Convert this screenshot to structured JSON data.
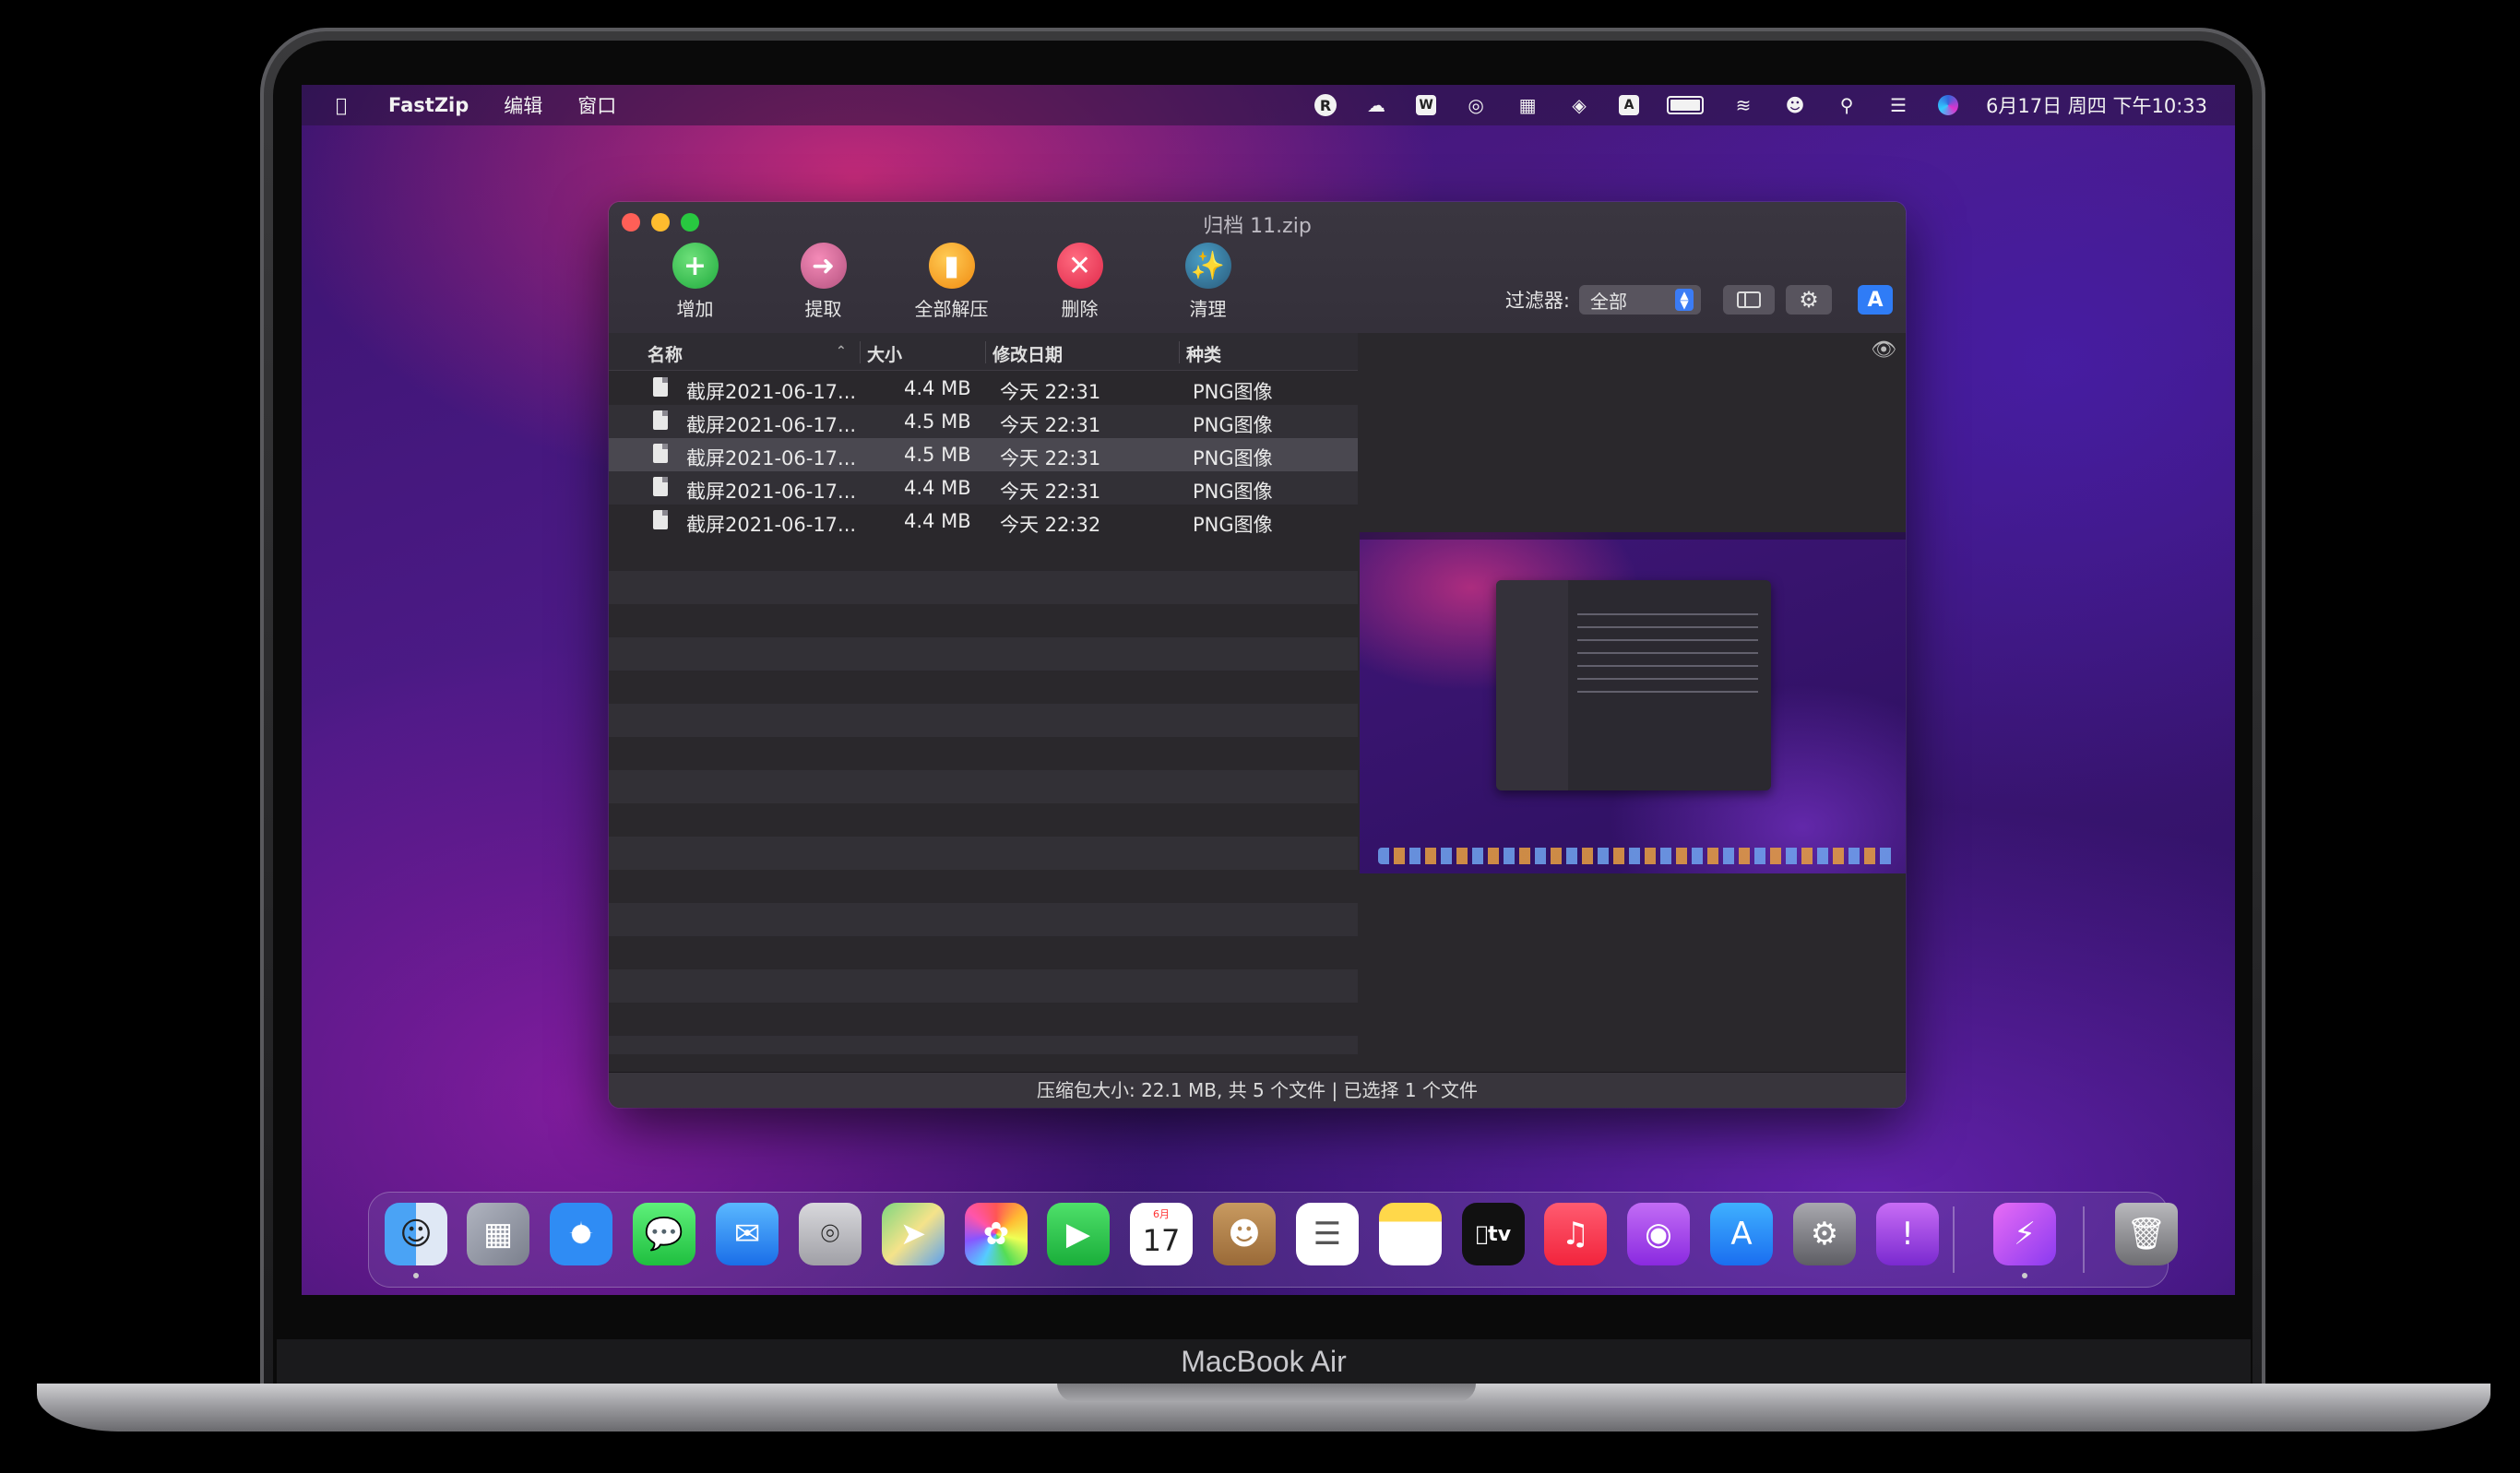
{
  "menubar": {
    "apple_icon": "apple-icon",
    "app_name": "FastZip",
    "menus": [
      "编辑",
      "窗口"
    ],
    "status_icons": [
      "r-badge-icon",
      "creative-cloud-icon",
      "w-badge-icon",
      "fingerprint-icon",
      "grid-icon",
      "layers-icon",
      "input-a-icon",
      "battery-icon",
      "wifi-icon",
      "user-icon",
      "search-icon",
      "control-center-icon",
      "siri-icon"
    ],
    "r_badge": "R",
    "w_badge": "W",
    "a_badge": "A",
    "clock": "6月17日 周四 下午10:33"
  },
  "window": {
    "title": "归档 11.zip",
    "toolbar": {
      "add": "增加",
      "extract": "提取",
      "extract_all": "全部解压",
      "delete": "删除",
      "clean": "清理"
    },
    "filter": {
      "label": "过滤器:",
      "value": "全部"
    },
    "columns": {
      "name": "名称",
      "size": "大小",
      "date": "修改日期",
      "kind": "种类"
    },
    "files": [
      {
        "name": "截屏2021-06-17...",
        "size": "4.4 MB",
        "date": "今天 22:31",
        "kind": "PNG图像"
      },
      {
        "name": "截屏2021-06-17...",
        "size": "4.5 MB",
        "date": "今天 22:31",
        "kind": "PNG图像"
      },
      {
        "name": "截屏2021-06-17...",
        "size": "4.5 MB",
        "date": "今天 22:31",
        "kind": "PNG图像"
      },
      {
        "name": "截屏2021-06-17...",
        "size": "4.4 MB",
        "date": "今天 22:31",
        "kind": "PNG图像"
      },
      {
        "name": "截屏2021-06-17...",
        "size": "4.4 MB",
        "date": "今天 22:32",
        "kind": "PNG图像"
      }
    ],
    "selected_row": 2,
    "status": "压缩包大小: 22.1 MB, 共 5 个文件 | 已选择 1 个文件"
  },
  "dock": {
    "apps": [
      "finder",
      "launchpad",
      "safari",
      "messages",
      "mail",
      "screenshot",
      "maps",
      "photos",
      "facetime",
      "calendar",
      "contacts",
      "reminders",
      "notes",
      "apple-tv",
      "music",
      "podcasts",
      "app-store",
      "system-preferences",
      "feedback",
      "fastzip",
      "trash"
    ],
    "calendar_month": "6月",
    "calendar_day": "17",
    "tv_label": "tv"
  },
  "device_label": "MacBook Air",
  "colors": {
    "accent": "#2f7cf6",
    "close": "#ff5f57",
    "minimize": "#febc2e",
    "maximize": "#28c840"
  }
}
